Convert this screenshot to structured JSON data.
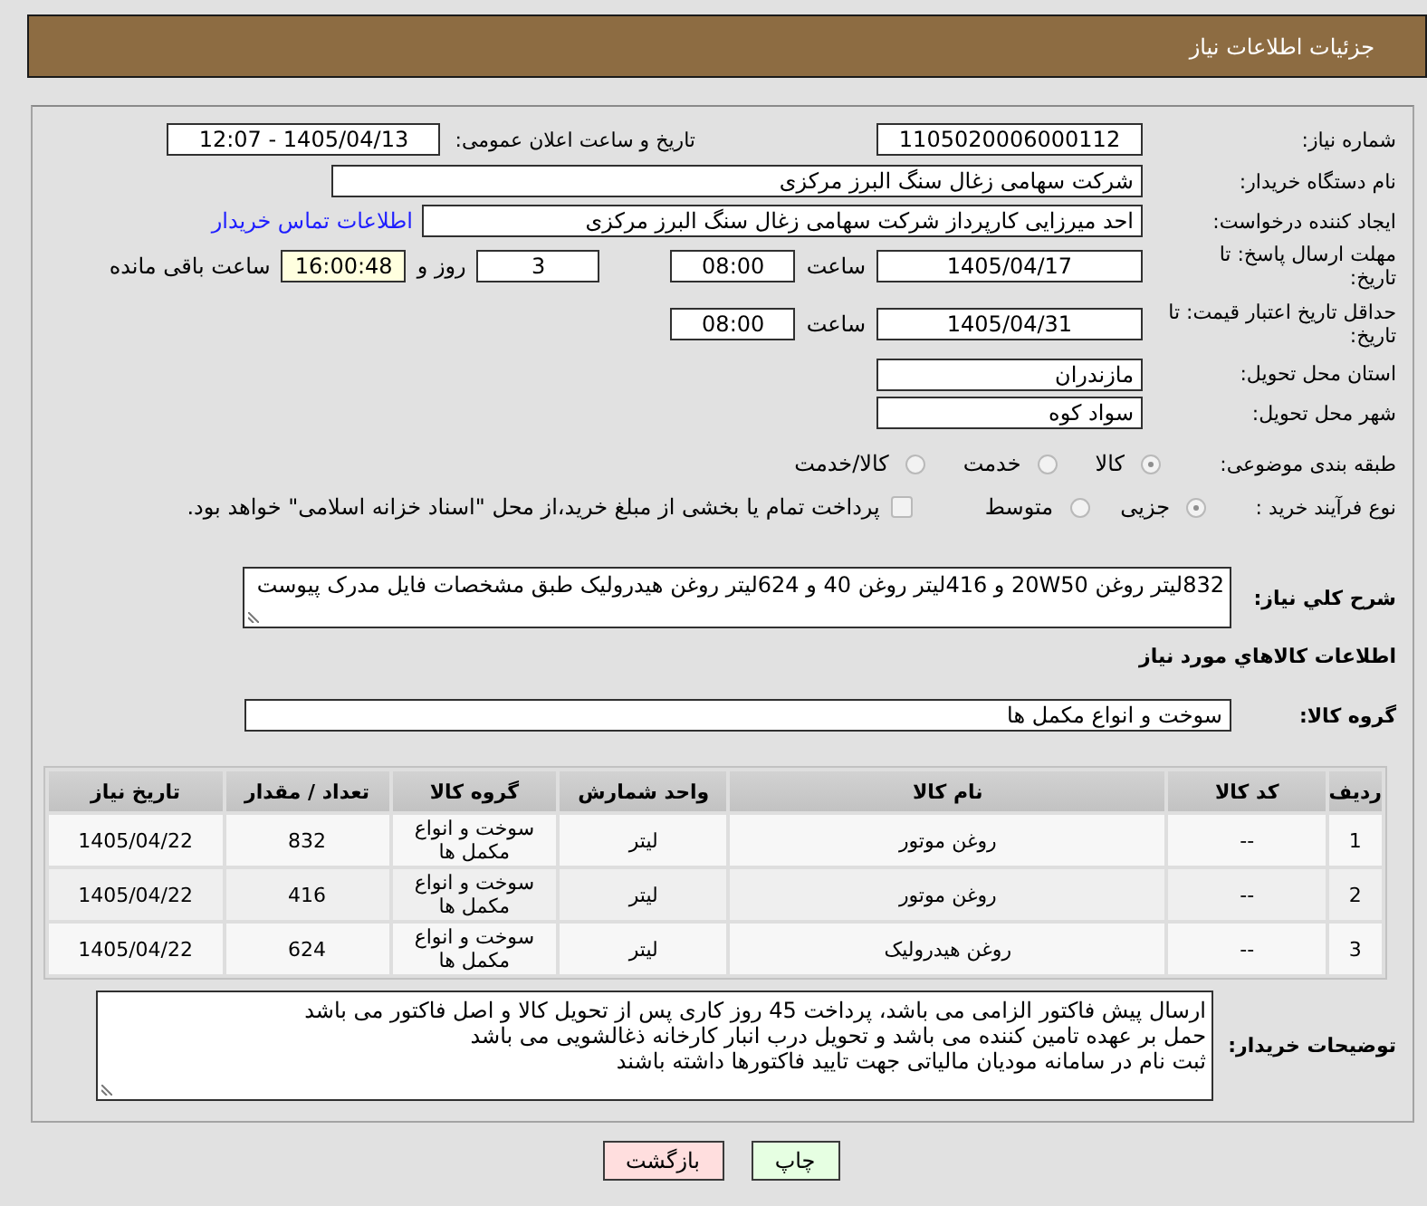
{
  "header": {
    "title": "جزئیات اطلاعات نیاز"
  },
  "need_number": {
    "label": "شماره نیاز:",
    "value": "1105020006000112"
  },
  "announcement": {
    "label": "تاریخ و ساعت اعلان عمومی:",
    "value": "1405/04/13 - 12:07"
  },
  "buyer_organization": {
    "label": "نام دستگاه خریدار:",
    "value": "شرکت سهامی زغال سنگ البرز مرکزی"
  },
  "requester": {
    "label": "ایجاد کننده درخواست:",
    "value": "احد میرزایی کارپرداز شرکت سهامی زغال سنگ البرز مرکزی",
    "contact_link": "اطلاعات تماس خریدار"
  },
  "reply_deadline": {
    "label": "مهلت ارسال پاسخ: تا تاریخ:",
    "date": "1405/04/17",
    "time_label": "ساعت",
    "time": "08:00",
    "days": "3",
    "days_label": "روز و",
    "remaining": "16:00:48",
    "remaining_label": "ساعت باقی مانده"
  },
  "price_validity": {
    "label": "حداقل تاریخ اعتبار قیمت: تا تاریخ:",
    "date": "1405/04/31",
    "time_label": "ساعت",
    "time": "08:00"
  },
  "delivery_province": {
    "label": "استان محل تحویل:",
    "value": "مازندران"
  },
  "delivery_city": {
    "label": "شهر محل تحویل:",
    "value": "سواد کوه"
  },
  "subject_category": {
    "label": "طبقه بندی موضوعی:",
    "options": [
      {
        "label": "کالا",
        "selected": true
      },
      {
        "label": "خدمت",
        "selected": false
      },
      {
        "label": "کالا/خدمت",
        "selected": false
      }
    ]
  },
  "purchase_process": {
    "label": "نوع فرآیند خرید :",
    "options": [
      {
        "label": "جزیی",
        "selected": true
      },
      {
        "label": "متوسط",
        "selected": false
      }
    ],
    "treasury_payment": {
      "label": "پرداخت تمام یا بخشی از مبلغ خرید،از محل \"اسناد خزانه اسلامی\" خواهد بود.",
      "checked": false
    }
  },
  "description": {
    "label": "شرح کلي نياز:",
    "value": "832لیتر روغن 20W50 و 416لیتر روغن 40 و 624لیتر روغن هیدرولیک طبق مشخصات فایل مدرک پیوست"
  },
  "goods_section": {
    "title": "اطلاعات کالاهاي مورد نياز"
  },
  "goods_group": {
    "label": "گروه کالا:",
    "value": "سوخت و انواع مکمل ها"
  },
  "table": {
    "columns": [
      "ردیف",
      "کد کالا",
      "نام کالا",
      "واحد شمارش",
      "گروه کالا",
      "تعداد / مقدار",
      "تاریخ نیاز"
    ],
    "rows": [
      [
        "1",
        "--",
        "روغن موتور",
        "لیتر",
        "سوخت و انواع مکمل ها",
        "832",
        "1405/04/22"
      ],
      [
        "2",
        "--",
        "روغن موتور",
        "لیتر",
        "سوخت و انواع مکمل ها",
        "416",
        "1405/04/22"
      ],
      [
        "3",
        "--",
        "روغن هیدرولیک",
        "لیتر",
        "سوخت و انواع مکمل ها",
        "624",
        "1405/04/22"
      ]
    ]
  },
  "buyer_notes": {
    "label": "توضیحات خریدار:",
    "lines": [
      "ارسال پیش فاکتور الزامی می باشد، پرداخت 45 روز کاری پس از تحویل کالا و اصل فاکتور می باشد",
      "حمل بر عهده تامین کننده می باشد و تحویل درب انبار کارخانه ذغالشویی می باشد",
      "ثبت نام در سامانه مودیان مالیاتی جهت تایید فاکتورها داشته باشند"
    ]
  },
  "buttons": [
    {
      "label": "چاپ",
      "kind": "print"
    },
    {
      "label": "بازگشت",
      "kind": "back"
    }
  ]
}
